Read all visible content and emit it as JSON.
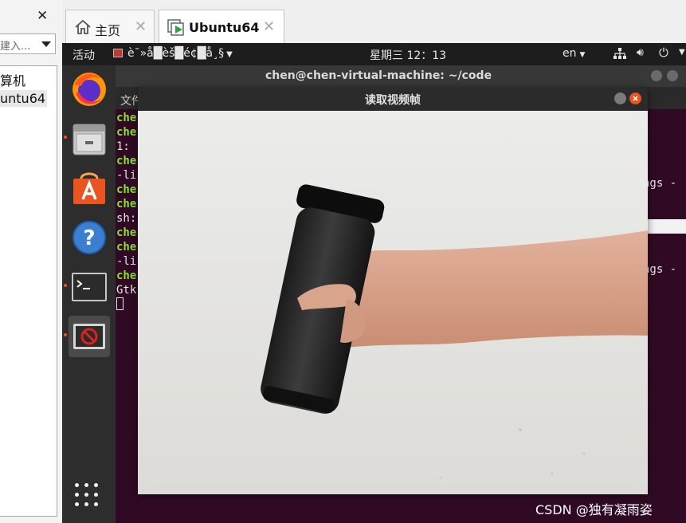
{
  "library": {
    "close_glyph": "✕",
    "search_placeholder": "建入...",
    "tree": [
      "算机",
      "untu64"
    ]
  },
  "tabs": [
    {
      "label": "主页",
      "close": "✕"
    },
    {
      "label": "Ubuntu64",
      "close": "✕"
    }
  ],
  "topbar": {
    "activities": "活动",
    "app_menu": "è¯»å█èš█é¢█å¸§",
    "clock": "星期三 12：13",
    "language": "en",
    "icons": [
      "network-icon",
      "volume-icon",
      "power-icon",
      "tray-menu-arrow-icon"
    ]
  },
  "dock": {
    "items": [
      "firefox-icon",
      "files-icon",
      "software-icon",
      "help-icon",
      "terminal-icon",
      "frame-viewer-icon"
    ],
    "show_apps": "show-applications-icon"
  },
  "terminal": {
    "title": "chen@chen-virtual-machine: ~/code",
    "menu_file": "文件",
    "lines": [
      {
        "prompt": "che",
        "text": ""
      },
      {
        "prompt": "che",
        "text": ""
      },
      {
        "prompt": "",
        "text": "1:"
      },
      {
        "prompt": "che",
        "text": ""
      },
      {
        "prompt": "",
        "text": "-li"
      },
      {
        "prompt": "che",
        "text": ""
      },
      {
        "prompt": "che",
        "text": ""
      },
      {
        "prompt": "",
        "text": "sh:"
      },
      {
        "prompt": "che",
        "text": ""
      },
      {
        "prompt": "che",
        "text": ""
      },
      {
        "prompt": "",
        "text": "-li"
      },
      {
        "prompt": "che",
        "text": ""
      },
      {
        "prompt": "",
        "text": "Gtk"
      }
    ],
    "right_fragment_1": "ags -",
    "right_fragment_2": "ags -"
  },
  "viewer": {
    "title": "读取视频帧"
  },
  "watermark": "CSDN @独有凝雨姿",
  "colors": {
    "ubuntu_orange": "#e95420",
    "terminal_bg": "#300a24",
    "prompt_green": "#8ae234"
  }
}
